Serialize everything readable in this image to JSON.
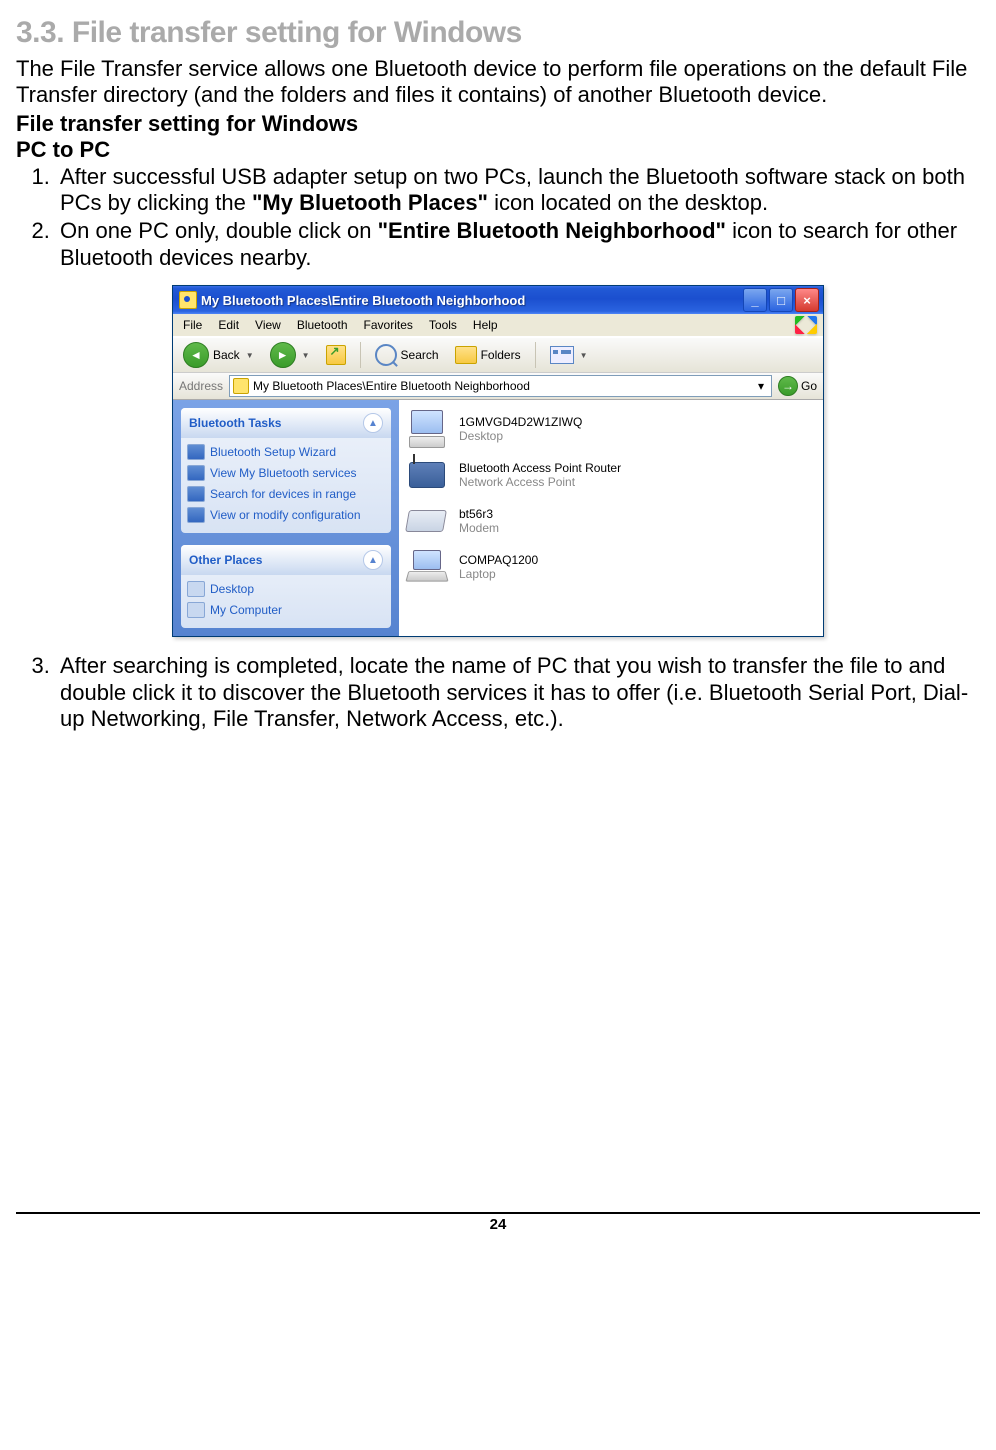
{
  "section_heading": "3.3. File transfer setting for Windows",
  "intro": "The File Transfer service allows one Bluetooth device to perform file operations on the default File Transfer directory (and the folders and files it contains) of another Bluetooth device.",
  "subhead1": "File transfer setting for Windows",
  "subhead2": "PC to PC",
  "steps12": [
    {
      "pre": "After successful USB adapter setup on two PCs, launch the Bluetooth software stack on both PCs by clicking the ",
      "bold": "\"My Bluetooth Places\"",
      "post": " icon located on the desktop."
    },
    {
      "pre": "On one PC only, double click on ",
      "bold": "\"Entire Bluetooth Neighborhood\"",
      "post": " icon to search for other Bluetooth devices nearby."
    }
  ],
  "step3": "After searching is completed, locate the name of PC that you wish to transfer the file to and double click it to discover the Bluetooth services it has to offer (i.e. Bluetooth Serial Port, Dial-up Networking, File Transfer, Network Access, etc.).",
  "page_number": "24",
  "xp": {
    "title": "My Bluetooth Places\\Entire Bluetooth Neighborhood",
    "menu": [
      "File",
      "Edit",
      "View",
      "Bluetooth",
      "Favorites",
      "Tools",
      "Help"
    ],
    "toolbar": {
      "back": "Back",
      "search": "Search",
      "folders": "Folders"
    },
    "address_label": "Address",
    "address_value": "My Bluetooth Places\\Entire Bluetooth Neighborhood",
    "go": "Go",
    "tasks_title": "Bluetooth Tasks",
    "tasks": [
      "Bluetooth Setup Wizard",
      "View My Bluetooth services",
      "Search for devices in range",
      "View or modify configuration"
    ],
    "other_title": "Other Places",
    "other": [
      "Desktop",
      "My Computer"
    ],
    "devices": [
      {
        "name": "1GMVGD4D2W1ZIWQ",
        "type": "Desktop",
        "icon": "desktop"
      },
      {
        "name": "Bluetooth Access Point Router",
        "type": "Network Access Point",
        "icon": "ap"
      },
      {
        "name": "bt56r3",
        "type": "Modem",
        "icon": "modem"
      },
      {
        "name": "COMPAQ1200",
        "type": "Laptop",
        "icon": "laptop"
      }
    ]
  }
}
